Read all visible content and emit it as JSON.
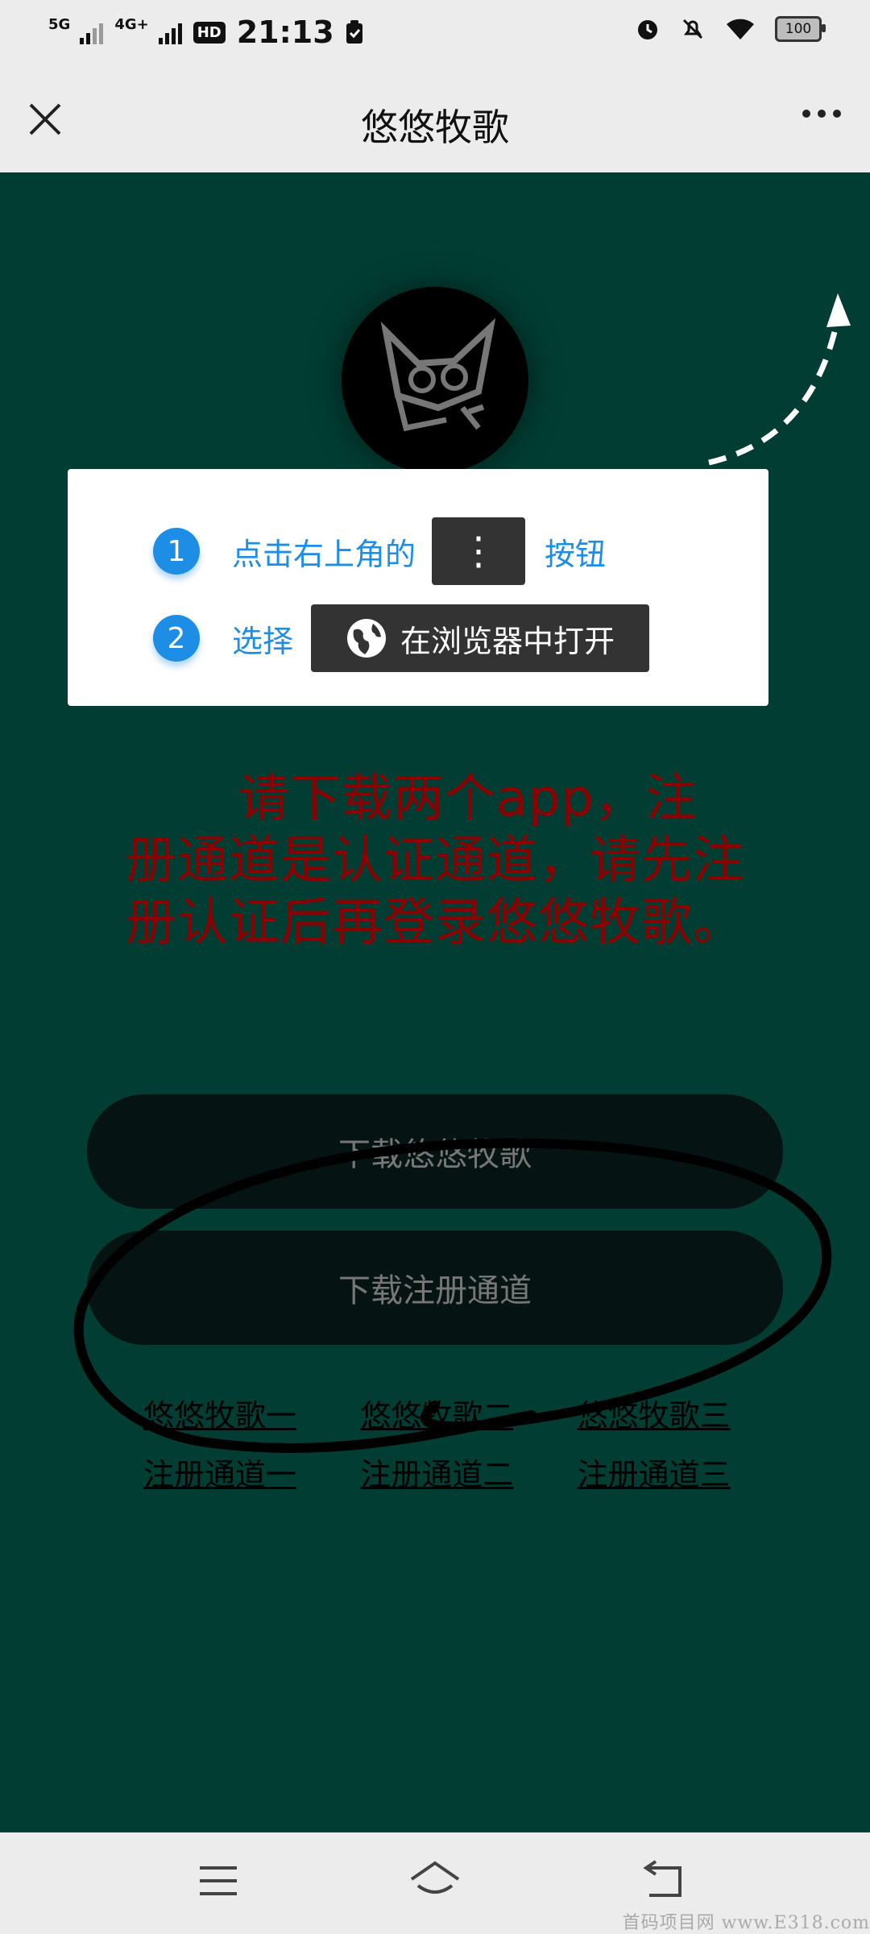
{
  "status_bar": {
    "network1": "5G",
    "network2": "4G+",
    "hd_badge": "HD",
    "time": "21:13",
    "battery": "100"
  },
  "header": {
    "title": "悠悠牧歌"
  },
  "tip": {
    "step1_num": "1",
    "step1_text": "点击右上角的",
    "step1_button": "⋮",
    "step1_after": "按钮",
    "step2_num": "2",
    "step2_text": "选择",
    "step2_button": "在浏览器中打开"
  },
  "notice": "请下载两个app，注册通道是认证通道，请先注册认证后再登录悠悠牧歌。",
  "buttons": {
    "download_app": "下载悠悠牧歌",
    "download_register": "下载注册通道"
  },
  "links": {
    "app1": "悠悠牧歌一",
    "app2": "悠悠牧歌二",
    "app3": "悠悠牧歌三",
    "reg1": "注册通道一",
    "reg2": "注册通道二",
    "reg3": "注册通道三"
  },
  "watermark": "首码项目网 www.E318.com",
  "colors": {
    "background": "#013d33",
    "accent_blue": "#1d8de6",
    "notice_red": "#8b0000",
    "bar_gray": "#ececec"
  },
  "icons": [
    "close-icon",
    "more-icon",
    "alarm-icon",
    "mute-icon",
    "wifi-icon",
    "battery-icon",
    "globe-icon",
    "menu-icon",
    "home-icon",
    "back-icon"
  ]
}
